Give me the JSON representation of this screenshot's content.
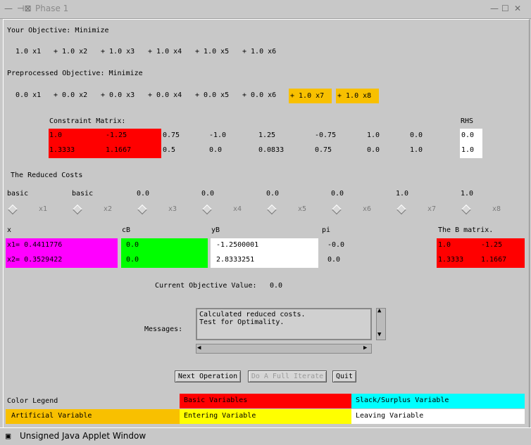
{
  "window": {
    "title": "Phase 1",
    "status": "Unsigned Java Applet Window"
  },
  "objective": {
    "label": "Your Objective: Minimize",
    "terms": [
      "1.0 x1",
      "+ 1.0 x2",
      "+ 1.0 x3",
      "+ 1.0 x4",
      "+ 1.0 x5",
      "+ 1.0 x6"
    ]
  },
  "preprocessed": {
    "label": "Preprocessed Objective: Minimize",
    "terms": [
      "0.0 x1",
      "+ 0.0 x2",
      "+ 0.0 x3",
      "+ 0.0 x4",
      "+ 0.0 x5",
      "+ 0.0 x6",
      "+ 1.0 x7",
      "+ 1.0 x8"
    ]
  },
  "constraint": {
    "label": "Constraint Matrix:",
    "rhs_label": "RHS",
    "rows": [
      [
        "1.0",
        "-1.25",
        "0.75",
        "-1.0",
        "1.25",
        "-0.75",
        "1.0",
        "0.0"
      ],
      [
        "1.3333",
        "1.1667",
        "0.5",
        "0.0",
        "0.0833",
        "0.75",
        "0.0",
        "1.0"
      ]
    ],
    "rhs": [
      "0.0",
      "1.0"
    ]
  },
  "reduced": {
    "label": "The Reduced Costs",
    "values": [
      "basic",
      "basic",
      "0.0",
      "0.0",
      "0.0",
      "0.0",
      "1.0",
      "1.0"
    ],
    "vars": [
      "x1",
      "x2",
      "x3",
      "x4",
      "x5",
      "x6",
      "x7",
      "x8"
    ]
  },
  "basis": {
    "headers": {
      "x": "x",
      "cb": "cB",
      "yb": "yB",
      "pi": "pi",
      "bmatrix": "The B matrix."
    },
    "x": [
      "x1= 0.4411776",
      "x2= 0.3529422"
    ],
    "cb": [
      "0.0",
      "0.0"
    ],
    "yb": [
      "-1.2500001",
      "2.8333251"
    ],
    "pi": [
      "-0.0",
      "0.0"
    ],
    "b": [
      [
        "1.0",
        "-1.25"
      ],
      [
        "1.3333",
        "1.1667"
      ]
    ]
  },
  "current": {
    "label": "Current Objective Value:",
    "value": "0.0"
  },
  "messages": {
    "label": "Messages:",
    "lines": [
      "Calculated reduced costs.",
      "Test for Optimality."
    ]
  },
  "buttons": {
    "next": "Next Operation",
    "full": "Do A Full Iterate",
    "quit": "Quit"
  },
  "legend": {
    "title": "Color Legend",
    "basic": "Basic Variables",
    "slack": "Slack/Surplus Variable",
    "artificial": "Artificial Variable",
    "entering": "Entering Variable",
    "leaving": "Leaving Variable"
  },
  "colors": {
    "basic": "#ff0000",
    "artificial": "#f8c000",
    "slack": "#00ffff",
    "entering": "#ffff00",
    "leaving": "#ffffff"
  }
}
